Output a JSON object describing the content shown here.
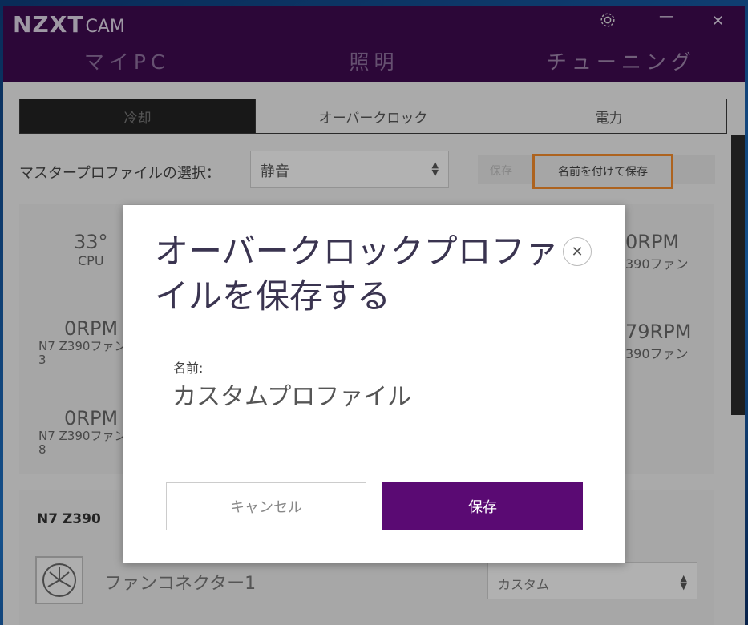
{
  "app": {
    "brand": "NZXT",
    "product": "CAM",
    "nav": [
      {
        "label": "マイPC"
      },
      {
        "label": "照明"
      },
      {
        "label": "チューニング"
      }
    ]
  },
  "tabs": [
    {
      "label": "冷却"
    },
    {
      "label": "オーバークロック"
    },
    {
      "label": "電力"
    }
  ],
  "profile": {
    "label": "マスタープロファイルの選択：",
    "selected": "静音",
    "save_label": "保存",
    "save_as_label": "名前を付けて保存"
  },
  "cards": {
    "cpu_temp": "33°",
    "cpu_label": "CPU",
    "fan_rpm_a": "0RPM",
    "fan_label_a": "N7 Z390ファン 3",
    "fan_rpm_b": "0RPM",
    "fan_label_b": "N7 Z390ファン 8",
    "right_rpm_1": "0RPM",
    "right_label_1": "390ファン",
    "right_rpm_2": "79RPM",
    "right_label_2": "390ファン"
  },
  "device": {
    "title": "N7 Z390",
    "fan_connector": "ファンコネクター1",
    "fan_mode": "カスタム"
  },
  "modal": {
    "title": "オーバークロックプロファイルを保存する",
    "name_label": "名前:",
    "name_value": "カスタムプロファイル",
    "cancel_label": "キャンセル",
    "save_label": "保存"
  }
}
